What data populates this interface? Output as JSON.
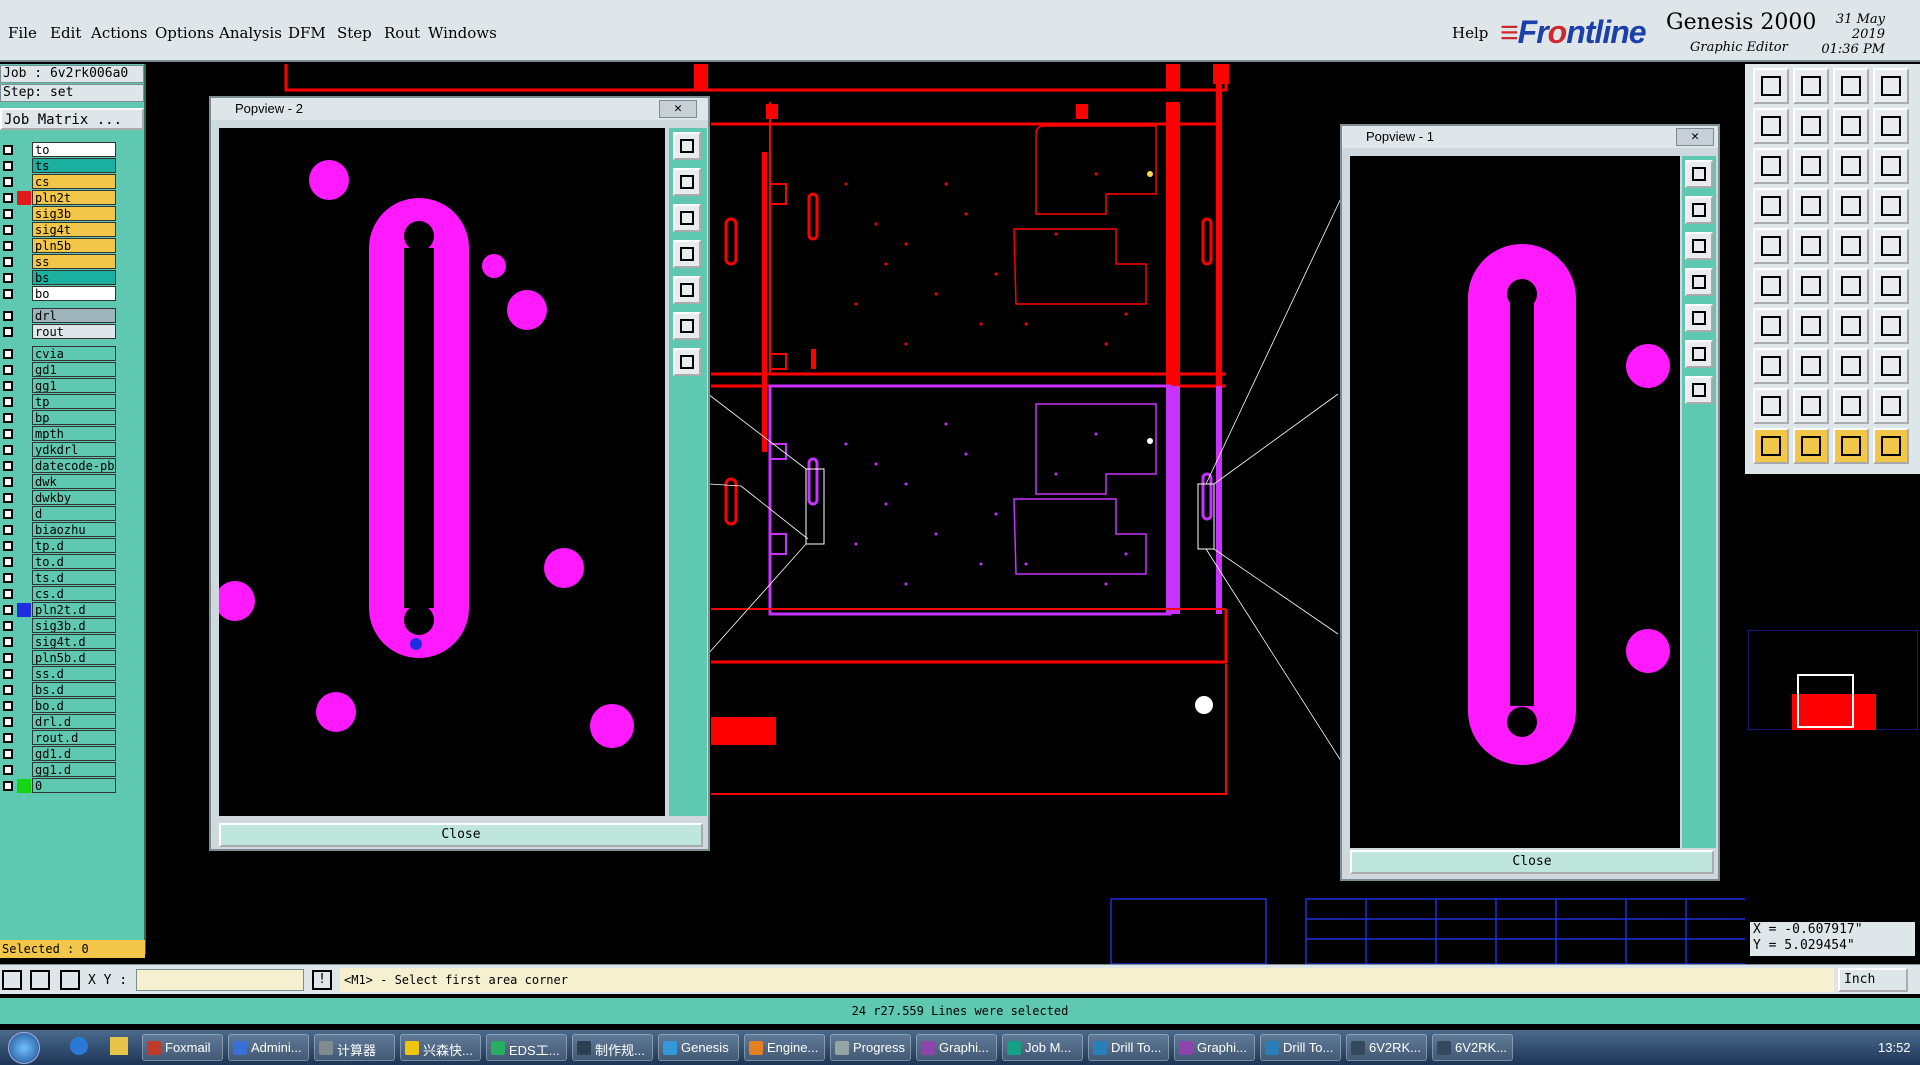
{
  "menubar": {
    "items": [
      "File",
      "Edit",
      "Actions",
      "Options",
      "Analysis",
      "DFM",
      "Step",
      "Rout",
      "Windows"
    ],
    "help": "Help",
    "brand_logo_prefix": "Fr",
    "brand_logo_o": "o",
    "brand_logo_rest": "ntline",
    "brand_name": "Genesis 2000",
    "brand_sub": "Graphic Editor",
    "date": "31 May 2019",
    "time": "01:36 PM"
  },
  "job": {
    "job_line": "Job :  6v2rk006a0",
    "step_line": "Step: set",
    "matrix_button": "Job Matrix ..."
  },
  "layers": [
    {
      "name": "to",
      "color": "#ffffff",
      "box": "#ffffff"
    },
    {
      "name": "ts",
      "color": "#1bb0a0",
      "box": "#1bb0a0"
    },
    {
      "name": "cs",
      "color": "#f2c649",
      "box": "#f2c649"
    },
    {
      "name": "pln2t",
      "color": "#f2c649",
      "box": "#f2c649",
      "active": "#e31a1c"
    },
    {
      "name": "sig3b",
      "color": "#f2c649",
      "box": "#f2c649"
    },
    {
      "name": "sig4t",
      "color": "#f2c649",
      "box": "#f2c649"
    },
    {
      "name": "pln5b",
      "color": "#f2c649",
      "box": "#f2c649"
    },
    {
      "name": "ss",
      "color": "#f2c649",
      "box": "#f2c649"
    },
    {
      "name": "bs",
      "color": "#1bb0a0",
      "box": "#1bb0a0"
    },
    {
      "name": "bo",
      "color": "#ffffff",
      "box": "#ffffff"
    },
    {
      "name": "drl",
      "color": "#9fb3bd",
      "box": "#9fb3bd"
    },
    {
      "name": "rout",
      "color": "#dfe6ea",
      "box": "#dfe6ea"
    },
    {
      "name": "cvia",
      "color": "#5fc8b0",
      "box": "#5fc8b0"
    },
    {
      "name": "gd1",
      "color": "#5fc8b0",
      "box": "#5fc8b0"
    },
    {
      "name": "gg1",
      "color": "#5fc8b0",
      "box": "#5fc8b0"
    },
    {
      "name": "tp",
      "color": "#5fc8b0",
      "box": "#5fc8b0"
    },
    {
      "name": "bp",
      "color": "#5fc8b0",
      "box": "#5fc8b0"
    },
    {
      "name": "mpth",
      "color": "#5fc8b0",
      "box": "#5fc8b0"
    },
    {
      "name": "ydkdrl",
      "color": "#5fc8b0",
      "box": "#5fc8b0"
    },
    {
      "name": "datecode-pb",
      "color": "#5fc8b0",
      "box": "#5fc8b0"
    },
    {
      "name": "dwk",
      "color": "#5fc8b0",
      "box": "#5fc8b0"
    },
    {
      "name": "dwkby",
      "color": "#5fc8b0",
      "box": "#5fc8b0"
    },
    {
      "name": "d",
      "color": "#5fc8b0",
      "box": "#5fc8b0"
    },
    {
      "name": "biaozhu",
      "color": "#5fc8b0",
      "box": "#5fc8b0"
    },
    {
      "name": "tp.d",
      "color": "#5fc8b0",
      "box": "#5fc8b0"
    },
    {
      "name": "to.d",
      "color": "#5fc8b0",
      "box": "#5fc8b0"
    },
    {
      "name": "ts.d",
      "color": "#5fc8b0",
      "box": "#5fc8b0"
    },
    {
      "name": "cs.d",
      "color": "#5fc8b0",
      "box": "#5fc8b0"
    },
    {
      "name": "pln2t.d",
      "color": "#5fc8b0",
      "box": "#5fc8b0",
      "active": "#1d2fe0"
    },
    {
      "name": "sig3b.d",
      "color": "#5fc8b0",
      "box": "#5fc8b0"
    },
    {
      "name": "sig4t.d",
      "color": "#5fc8b0",
      "box": "#5fc8b0"
    },
    {
      "name": "pln5b.d",
      "color": "#5fc8b0",
      "box": "#5fc8b0"
    },
    {
      "name": "ss.d",
      "color": "#5fc8b0",
      "box": "#5fc8b0"
    },
    {
      "name": "bs.d",
      "color": "#5fc8b0",
      "box": "#5fc8b0"
    },
    {
      "name": "bo.d",
      "color": "#5fc8b0",
      "box": "#5fc8b0"
    },
    {
      "name": "drl.d",
      "color": "#5fc8b0",
      "box": "#5fc8b0"
    },
    {
      "name": "rout.d",
      "color": "#5fc8b0",
      "box": "#5fc8b0"
    },
    {
      "name": "gd1.d",
      "color": "#5fc8b0",
      "box": "#5fc8b0"
    },
    {
      "name": "gg1.d",
      "color": "#5fc8b0",
      "box": "#5fc8b0"
    },
    {
      "name": "0",
      "color": "#5fc8b0",
      "box": "#5fc8b0",
      "active": "#14d614"
    }
  ],
  "selected": "Selected : 0",
  "popview2": {
    "title": "Popview - 2",
    "close": "Close"
  },
  "popview1": {
    "title": "Popview - 1",
    "close": "Close"
  },
  "coords": {
    "x": "X = -0.607917\"",
    "y": "Y = 5.029454\""
  },
  "cmd": {
    "xy_label": "X Y :",
    "prompt": "<M1> - Select first area corner",
    "units": "Inch"
  },
  "message": "24 r27.559 Lines were selected",
  "taskbar": {
    "items": [
      "Foxmail",
      "Admini...",
      "计算器",
      "兴森快...",
      "EDS工...",
      "制作规...",
      "Genesis",
      "Engine...",
      "Progress",
      "Graphi...",
      "Job M...",
      "Drill To...",
      "Graphi...",
      "Drill To...",
      "6V2RK...",
      "6V2RK..."
    ],
    "clock": "13:52"
  }
}
